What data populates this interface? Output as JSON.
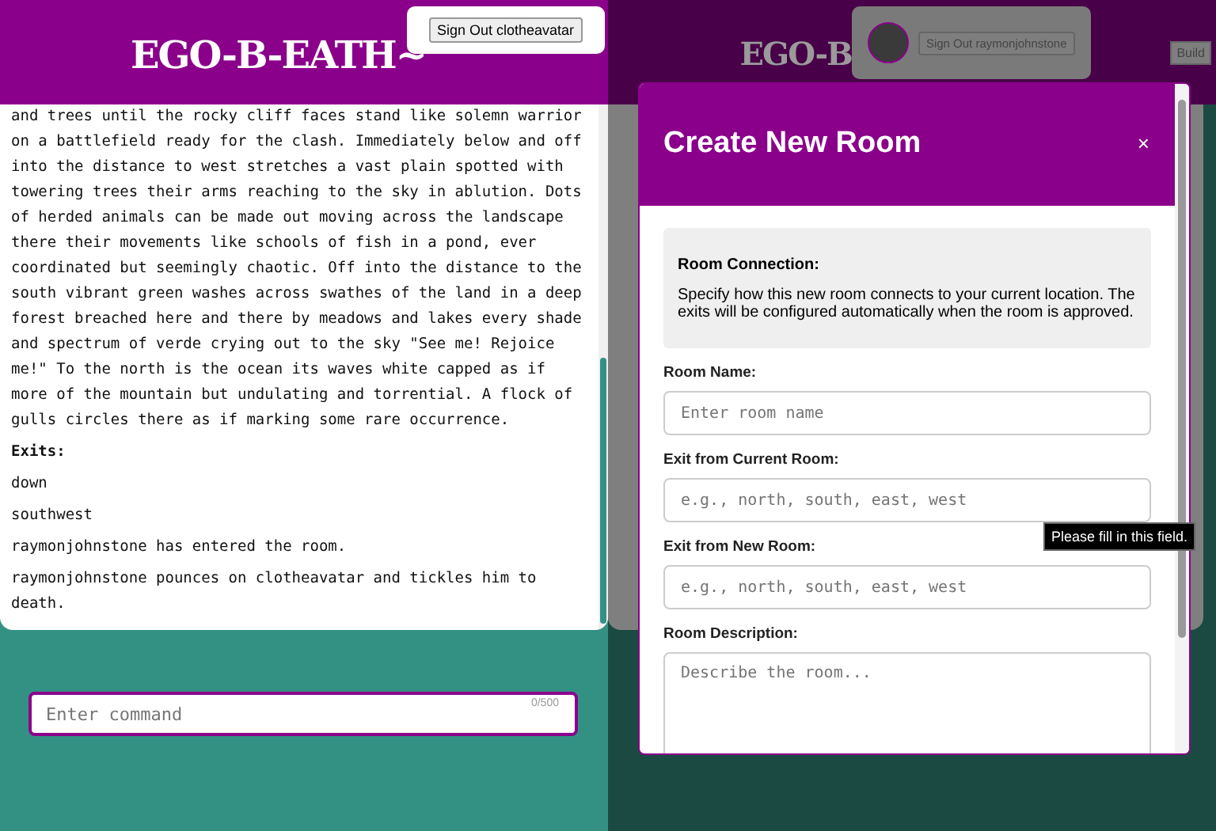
{
  "left": {
    "logo": "EGO-B-EATH~",
    "sign_out": "Sign Out clotheavatar",
    "description": "and trees until the rocky cliff faces stand like solemn warrior on a battlefield ready for the clash. Immediately below and off into the distance to west stretches a vast plain spotted with towering trees their arms reaching to the sky in ablution. Dots of herded animals can be made out moving across the landscape there their movements like schools of fish in a pond, ever coordinated but seemingly chaotic. Off into the distance to the south vibrant green washes across swathes of the land in a deep forest breached here and there by meadows and lakes every shade and spectrum of verde crying out to the sky \"See me! Rejoice me!\" To the north is the ocean its waves white capped as if more of the mountain but undulating and torrential. A flock of gulls circles there as if marking some rare occurrence.",
    "messages": [
      {
        "kind": "heading",
        "text": "Exits:"
      },
      {
        "kind": "line",
        "text": "down"
      },
      {
        "kind": "line",
        "text": "southwest"
      },
      {
        "kind": "line",
        "text": "raymonjohnstone has entered the room."
      },
      {
        "kind": "line",
        "text": "raymonjohnstone pounces on clotheavatar and tickles him to death."
      }
    ],
    "command": {
      "placeholder": "Enter command",
      "counter": "0/500"
    }
  },
  "right": {
    "logo": "EGO-B",
    "sign_out": "Sign Out raymonjohnstone",
    "build": "Build",
    "modal": {
      "title": "Create New Room",
      "close": "×",
      "info": {
        "heading": "Room Connection:",
        "text": "Specify how this new room connects to your current location. The exits will be configured automatically when the room is approved."
      },
      "fields": [
        {
          "kind": "input",
          "label": "Room Name:",
          "placeholder": "Enter room name"
        },
        {
          "kind": "input",
          "label": "Exit from Current Room:",
          "placeholder": "e.g., north, south, east, west"
        },
        {
          "kind": "input",
          "label": "Exit from New Room:",
          "placeholder": "e.g., north, south, east, west"
        },
        {
          "kind": "textarea",
          "label": "Room Description:",
          "placeholder": "Describe the room..."
        }
      ],
      "tooltip": "Please fill in this field."
    }
  }
}
